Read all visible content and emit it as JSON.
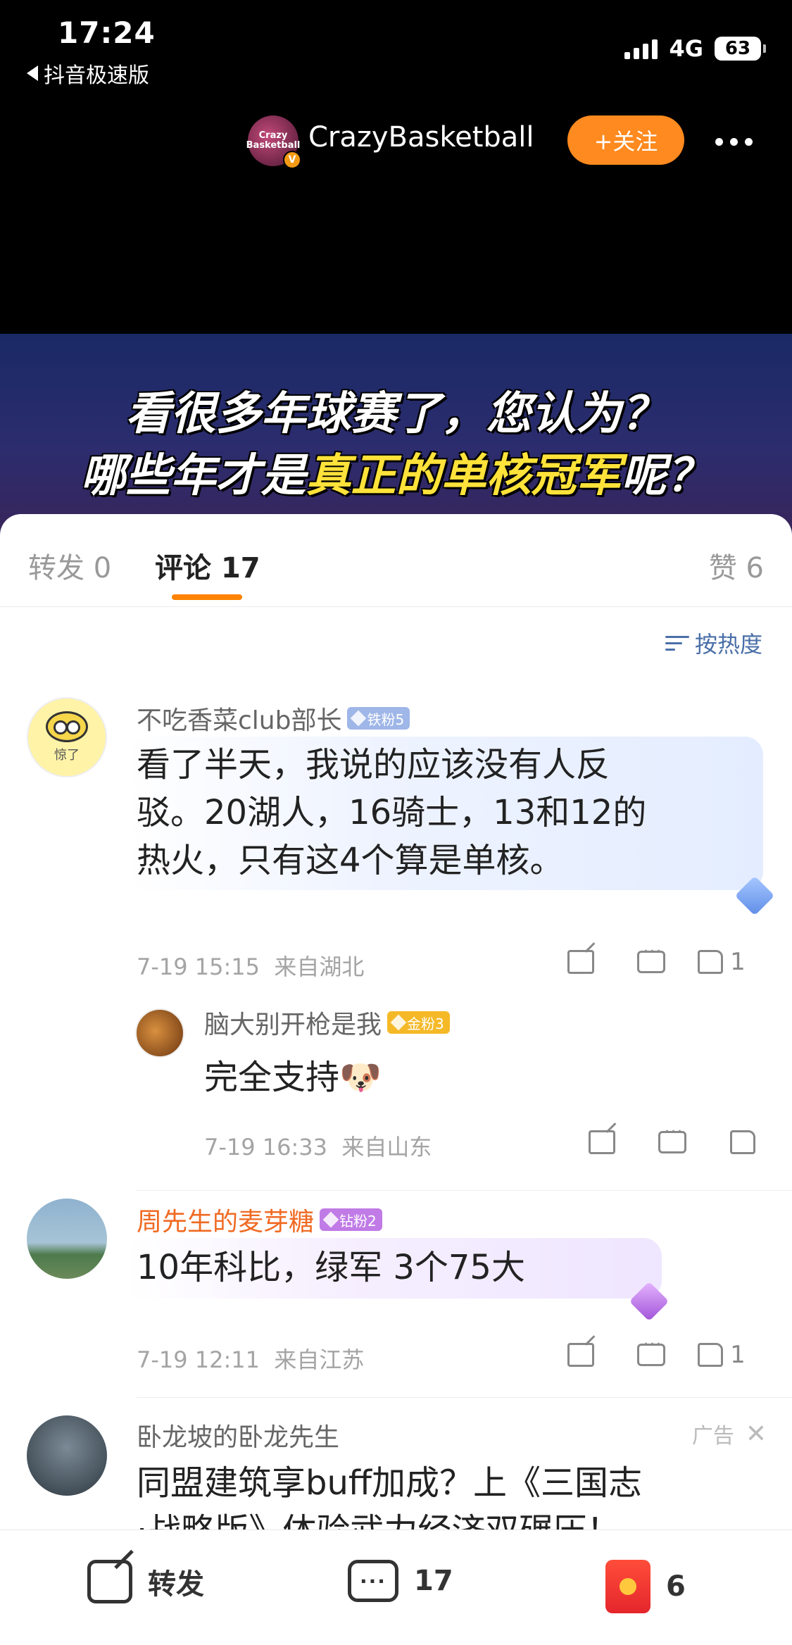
{
  "status_bar": {
    "time": "17:24",
    "back_app": "抖音极速版",
    "network": "4G",
    "battery": "63"
  },
  "video": {
    "author": "CrazyBasketball",
    "avatar_text": "Crazy Basketball",
    "verified_mark": "V",
    "follow_label": "+关注",
    "banner_line1": "看很多年球赛了，您认为？",
    "banner_line2_a": "哪些年才是",
    "banner_line2_highlight": "真正的单核冠军",
    "banner_line2_b": "呢？"
  },
  "tabs": {
    "repost_label": "转发",
    "repost_count": "0",
    "comment_label": "评论",
    "comment_count": "17",
    "like_label": "赞",
    "like_count": "6"
  },
  "sort_label": "按热度",
  "comments": [
    {
      "avatar_caption": "惊了",
      "name": "不吃香菜club部长",
      "badge": "铁粉5",
      "line1": "看了半天，我说的应该没有人反",
      "line2": "驳。20湖人，16骑士，13和12的",
      "line3": "热火，只有这4个算是单核。",
      "time": "7-19 15:15",
      "location": "来自湖北",
      "likes": "1"
    },
    {
      "name": "脑大别开枪是我",
      "badge": "金粉3",
      "text": "完全支持🐶",
      "time": "7-19 16:33",
      "location": "来自山东"
    },
    {
      "name": "周先生的麦芽糖",
      "badge": "钻粉2",
      "text": "10年科比，绿军 3个75大",
      "time": "7-19 12:11",
      "location": "来自江苏",
      "likes": "1"
    }
  ],
  "ad": {
    "name": "卧龙坡的卧龙先生",
    "tag": "广告",
    "close": "✕",
    "line1": "同盟建筑享buff加成？上《三国志",
    "line2": "·战略版》体验武力经济双碾压！"
  },
  "bottom_bar": {
    "repost_label": "转发",
    "comment_count": "17",
    "like_count": "6"
  },
  "colors": {
    "accent_orange": "#ff8200",
    "follow_button": "#ff8a1f",
    "link_blue": "#4a6fa8",
    "username_orange": "#f06a22",
    "highlight_yellow": "#ffe23a"
  }
}
